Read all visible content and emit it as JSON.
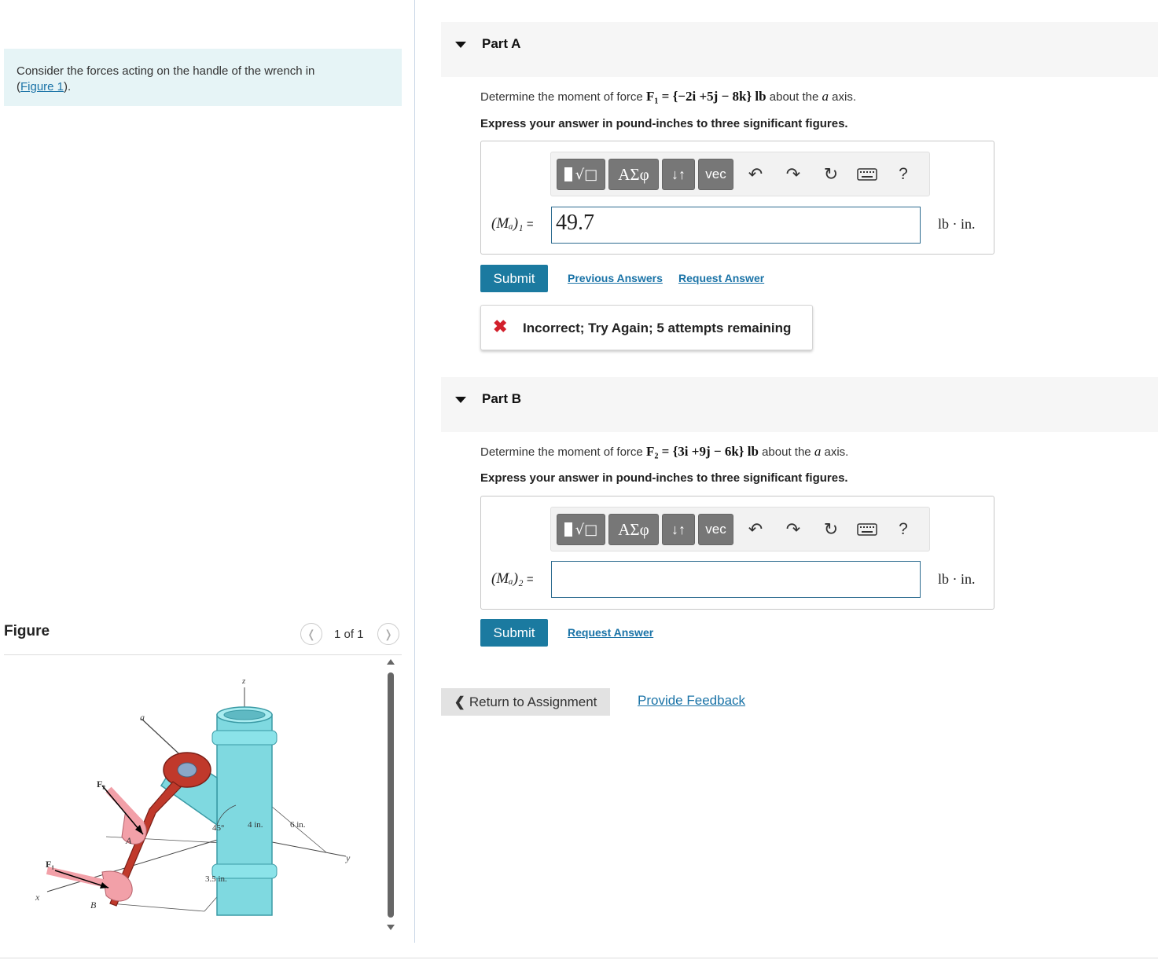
{
  "intro": {
    "text": "Consider the forces acting on the handle of the wrench in",
    "link_open": "(",
    "link": "Figure 1",
    "link_close": ")."
  },
  "figure_panel": {
    "title": "Figure",
    "page_indicator": "1 of 1",
    "labels": {
      "z": "z",
      "a": "a",
      "F2": "F₂",
      "F1": "F₁",
      "A": "A",
      "B": "B",
      "x": "x",
      "y": "y",
      "angle": "45°",
      "dim_4": "4 in.",
      "dim_6": "6 in.",
      "dim_35": "3.5 in."
    }
  },
  "toolbar": {
    "templates_icon": "√□",
    "greek": "ΑΣφ",
    "arrows": "↓↑",
    "vec": "vec",
    "help": "?"
  },
  "part_a": {
    "label": "Part A",
    "question_prefix": "Determine the moment of force ",
    "force_expr": "F₁ = {−2i +5j − 8k} lb",
    "question_suffix": " about the ",
    "axis": "a",
    "question_end": " axis.",
    "instruction": "Express your answer in pound-inches to three significant figures.",
    "var_label": "(Mₐ)₁",
    "equals": " =",
    "answer_value": "49.7",
    "unit": "lb · in.",
    "submit": "Submit",
    "previous_answers": "Previous Answers",
    "request_answer": "Request Answer",
    "feedback": "Incorrect; Try Again; 5 attempts remaining"
  },
  "part_b": {
    "label": "Part B",
    "question_prefix": "Determine the moment of force ",
    "force_expr": "F₂ = {3i +9j − 6k} lb",
    "question_suffix": " about the ",
    "axis": "a",
    "question_end": " axis.",
    "instruction": "Express your answer in pound-inches to three significant figures.",
    "var_label": "(Mₐ)₂",
    "equals": " =",
    "answer_value": "",
    "unit": "lb · in.",
    "submit": "Submit",
    "request_answer": "Request Answer"
  },
  "footer": {
    "return": "Return to Assignment",
    "provide_feedback": "Provide Feedback"
  },
  "colors": {
    "intro_bg": "#e6f4f6",
    "link": "#1a73a7",
    "submit_bg": "#1b7aa0",
    "toolbar_btn": "#777777",
    "error_x": "#d21f2b",
    "pipe": "#7fd9e0",
    "wrench": "#c0392b",
    "hand": "#f2a0a8"
  }
}
